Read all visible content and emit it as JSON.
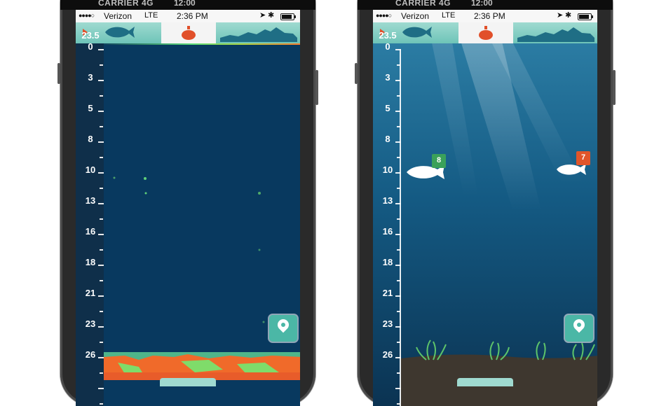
{
  "carrier_bar": {
    "carrier": "CARRIER 4G",
    "time": "12:00"
  },
  "status_bar": {
    "carrier": "Verizon",
    "network": "LTE",
    "time": "2:36 PM",
    "battery_level": 0.85
  },
  "tabs": [
    {
      "name": "fish-view",
      "icon": "fish-icon"
    },
    {
      "name": "deeper-device",
      "icon": "sonar-drop-icon"
    },
    {
      "name": "bottom-profile",
      "icon": "terrain-icon"
    }
  ],
  "left_screen": {
    "max_depth": "23.5",
    "depth_labels": [
      "0",
      "3",
      "5",
      "8",
      "10",
      "13",
      "16",
      "18",
      "21",
      "23",
      "26"
    ],
    "color_scale": [
      "#1e6b5a",
      "#5fe07a",
      "#ff7a2a"
    ]
  },
  "right_screen": {
    "max_depth": "23.5",
    "depth_labels": [
      "0",
      "3",
      "5",
      "8",
      "10",
      "13",
      "16",
      "18",
      "21",
      "23",
      "26"
    ],
    "fish": [
      {
        "depth_label": "8",
        "badge_color": "green"
      },
      {
        "depth_label": "7",
        "badge_color": "orange"
      }
    ]
  },
  "colors": {
    "sonar_bg": "#08395f",
    "water_top": "#2d7fa6",
    "water_bottom": "#0b3352",
    "accent": "#4bb7a6",
    "tab_active": "#e1502a"
  }
}
